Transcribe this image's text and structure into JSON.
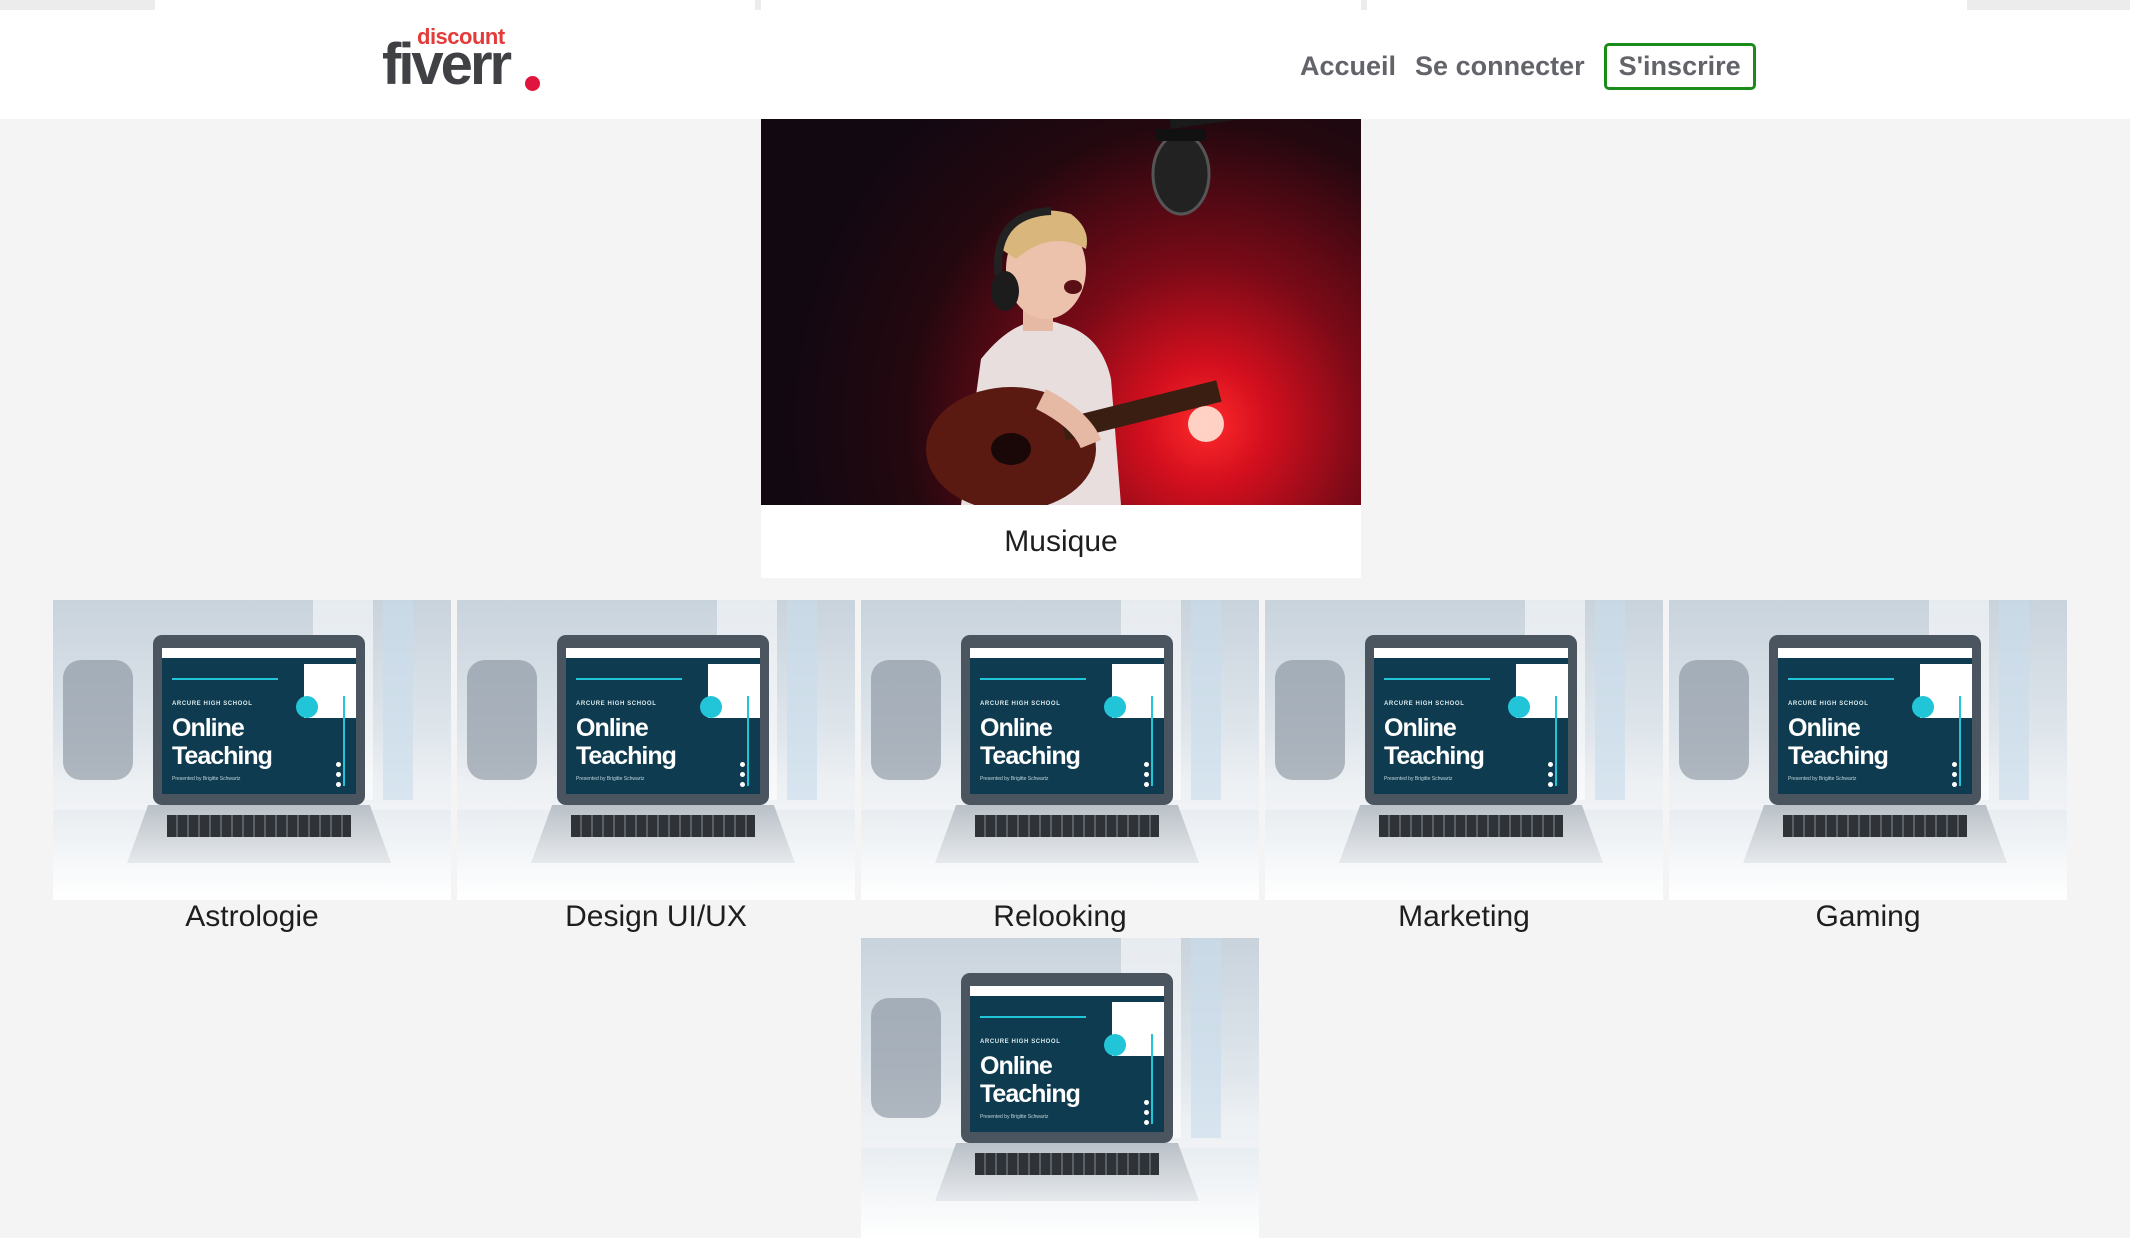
{
  "header": {
    "logo_small": "discount",
    "logo_main": "fiverr",
    "nav": {
      "home": "Accueil",
      "login": "Se connecter",
      "signup": "S'inscrire"
    }
  },
  "colors": {
    "logo_accent": "#e0143c",
    "signup_border": "#1a8c1a",
    "nav_text": "#62646a",
    "page_bg": "#f4f4f4"
  },
  "featured": {
    "label": "Musique"
  },
  "laptop_screen": {
    "school": "ARCURE HIGH SCHOOL",
    "title_line1": "Online",
    "title_line2": "Teaching",
    "presented": "Presented by Brigitte Schwartz"
  },
  "categories": [
    {
      "label": "Astrologie"
    },
    {
      "label": "Design UI/UX"
    },
    {
      "label": "Relooking"
    },
    {
      "label": "Marketing"
    },
    {
      "label": "Gaming"
    }
  ]
}
